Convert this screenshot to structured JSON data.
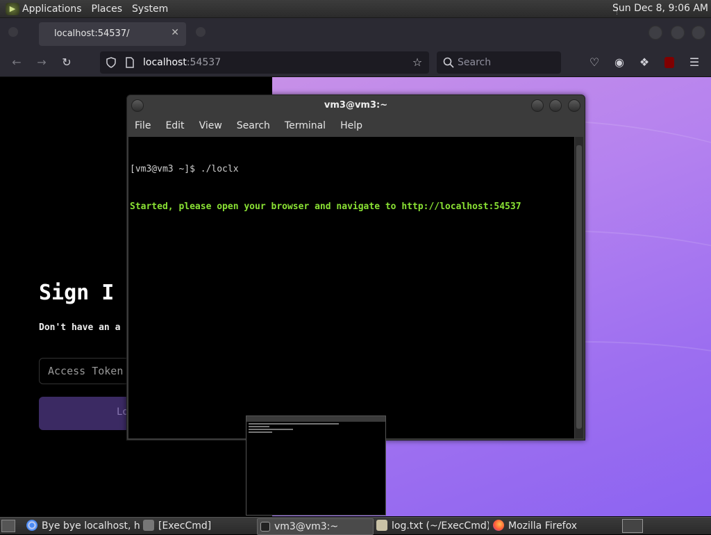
{
  "top_panel": {
    "menus": [
      "Applications",
      "Places",
      "System"
    ],
    "clock": "Sun Dec  8,  9:06 AM"
  },
  "browser": {
    "tab_title": "localhost:54537/",
    "url_host": "localhost",
    "url_port": ":54537",
    "search_placeholder": "Search"
  },
  "page": {
    "heading": "Sign I",
    "subtext": "Don't have an a",
    "token_placeholder": "Access Token",
    "login_label": "Lo"
  },
  "terminal": {
    "title": "vm3@vm3:~",
    "menu": [
      "File",
      "Edit",
      "View",
      "Search",
      "Terminal",
      "Help"
    ],
    "lines": [
      "[vm3@vm3 ~]$ ./loclx",
      "Started, please open your browser and navigate to http://localhost:54537"
    ]
  },
  "taskbar": {
    "items": [
      {
        "label": "Bye bye localhost, h...",
        "icon": "chrome-icon"
      },
      {
        "label": "[ExecCmd]",
        "icon": "folder-icon"
      },
      {
        "label": "vm3@vm3:~",
        "icon": "terminal-icon"
      },
      {
        "label": "log.txt (~/ExecCmd)...",
        "icon": "text-editor-icon"
      },
      {
        "label": "Mozilla Firefox",
        "icon": "firefox-icon"
      }
    ]
  },
  "colors": {
    "terminal_green": "#8ae234",
    "page_gradient_start": "#c790e8",
    "page_gradient_end": "#8c63f1",
    "login_button": "#3b2a63"
  }
}
